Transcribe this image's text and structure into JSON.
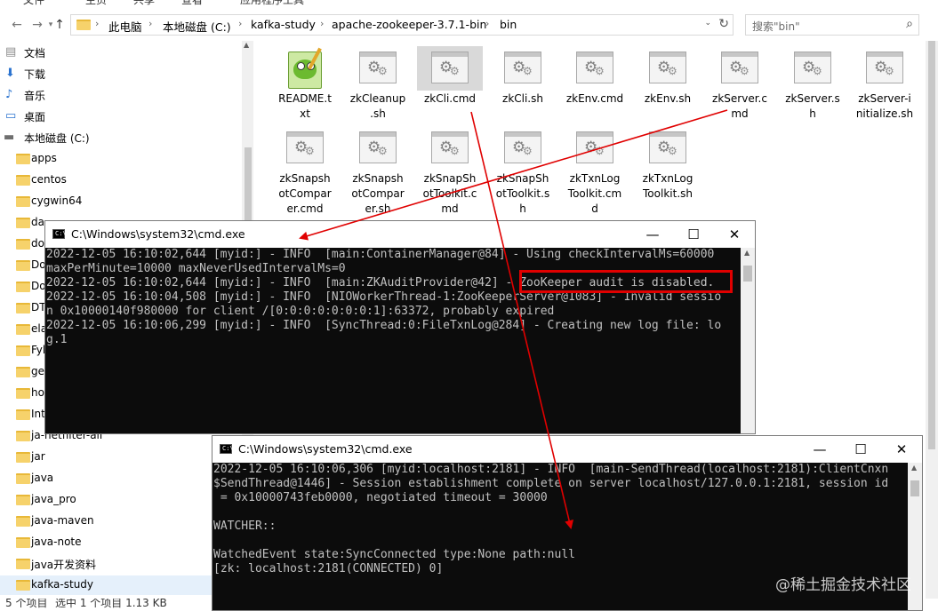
{
  "ribbon": {
    "tabs": [
      "文件",
      "主页",
      "共享",
      "查看",
      "应用程序工具"
    ]
  },
  "address": {
    "crumbs": [
      "此电脑",
      "本地磁盘 (C:)",
      "kafka-study",
      "apache-zookeeper-3.7.1-bin",
      "bin"
    ]
  },
  "search": {
    "placeholder": "搜索\"bin\""
  },
  "navpane": {
    "items": [
      {
        "label": "文档",
        "kind": "docs"
      },
      {
        "label": "下载",
        "kind": "download"
      },
      {
        "label": "音乐",
        "kind": "music"
      },
      {
        "label": "桌面",
        "kind": "desktop"
      },
      {
        "label": "本地磁盘 (C:)",
        "kind": "drive"
      },
      {
        "label": "apps",
        "kind": "folder"
      },
      {
        "label": "centos",
        "kind": "folder"
      },
      {
        "label": "cygwin64",
        "kind": "folder"
      },
      {
        "label": "da",
        "kind": "folder"
      },
      {
        "label": "do",
        "kind": "folder"
      },
      {
        "label": "Do",
        "kind": "folder"
      },
      {
        "label": "Do",
        "kind": "folder"
      },
      {
        "label": "DT",
        "kind": "folder"
      },
      {
        "label": "ela",
        "kind": "folder"
      },
      {
        "label": "Fyl",
        "kind": "folder"
      },
      {
        "label": "ge",
        "kind": "folder"
      },
      {
        "label": "ho",
        "kind": "folder"
      },
      {
        "label": "Int",
        "kind": "folder"
      },
      {
        "label": "ja-netfilter-all",
        "kind": "folder"
      },
      {
        "label": "jar",
        "kind": "folder"
      },
      {
        "label": "java",
        "kind": "folder"
      },
      {
        "label": "java_pro",
        "kind": "folder"
      },
      {
        "label": "java-maven",
        "kind": "folder"
      },
      {
        "label": "java-note",
        "kind": "folder"
      },
      {
        "label": "java开发资料",
        "kind": "folder"
      },
      {
        "label": "kafka-study",
        "kind": "folder",
        "selected": true
      }
    ]
  },
  "files": [
    {
      "name": "README.txt",
      "icon": "notepad-plus-icon"
    },
    {
      "name": "zkCleanup.sh",
      "icon": "gear-file-icon"
    },
    {
      "name": "zkCli.cmd",
      "icon": "gear-file-icon",
      "selected": true
    },
    {
      "name": "zkCli.sh",
      "icon": "gear-file-icon"
    },
    {
      "name": "zkEnv.cmd",
      "icon": "gear-file-icon"
    },
    {
      "name": "zkEnv.sh",
      "icon": "gear-file-icon"
    },
    {
      "name": "zkServer.cmd",
      "icon": "gear-file-icon"
    },
    {
      "name": "zkServer.sh",
      "icon": "gear-file-icon"
    },
    {
      "name": "zkServer-initialize.sh",
      "icon": "gear-file-icon"
    },
    {
      "name": "zkSnapshotComparer.cmd",
      "icon": "gear-file-icon"
    },
    {
      "name": "zkSnapshotComparer.sh",
      "icon": "gear-file-icon"
    },
    {
      "name": "zkSnapShotToolkit.cmd",
      "icon": "gear-file-icon"
    },
    {
      "name": "zkSnapShotToolkit.sh",
      "icon": "gear-file-icon"
    },
    {
      "name": "zkTxnLogToolkit.cmd",
      "icon": "gear-file-icon"
    },
    {
      "name": "zkTxnLogToolkit.sh",
      "icon": "gear-file-icon"
    }
  ],
  "status": {
    "count": "5 个项目",
    "selection": "选中 1 个项目  1.13 KB"
  },
  "cmd_server": {
    "title": "C:\\Windows\\system32\\cmd.exe",
    "lines": [
      "2022-12-05 16:10:02,644 [myid:] - INFO  [main:ContainerManager@84] - Using checkIntervalMs=60000",
      "maxPerMinute=10000 maxNeverUsedIntervalMs=0",
      "2022-12-05 16:10:02,644 [myid:] - INFO  [main:ZKAuditProvider@42] - ZooKeeper audit is disabled.",
      "2022-12-05 16:10:04,508 [myid:] - INFO  [NIOWorkerThread-1:ZooKeeperServer@1083] - Invalid sessio",
      "n 0x10000140f980000 for client /[0:0:0:0:0:0:0:1]:63372, probably expired",
      "2022-12-05 16:10:06,299 [myid:] - INFO  [SyncThread:0:FileTxnLog@284] - Creating new log file: lo",
      "g.1"
    ]
  },
  "cmd_client": {
    "title": "C:\\Windows\\system32\\cmd.exe",
    "lines": [
      "2022-12-05 16:10:06,306 [myid:localhost:2181] - INFO  [main-SendThread(localhost:2181):ClientCnxn",
      "$SendThread@1446] - Session establishment complete on server localhost/127.0.0.1:2181, session id",
      " = 0x10000743feb0000, negotiated timeout = 30000",
      "",
      "WATCHER::",
      "",
      "WatchedEvent state:SyncConnected type:None path:null",
      "[zk: localhost:2181(CONNECTED) 0]"
    ]
  },
  "watermark": "@稀土掘金技术社区",
  "colors": {
    "annotation": "#e00000",
    "console_bg": "#0c0c0c",
    "console_fg": "#c0c0c0",
    "selection": "#d9d9d9"
  }
}
